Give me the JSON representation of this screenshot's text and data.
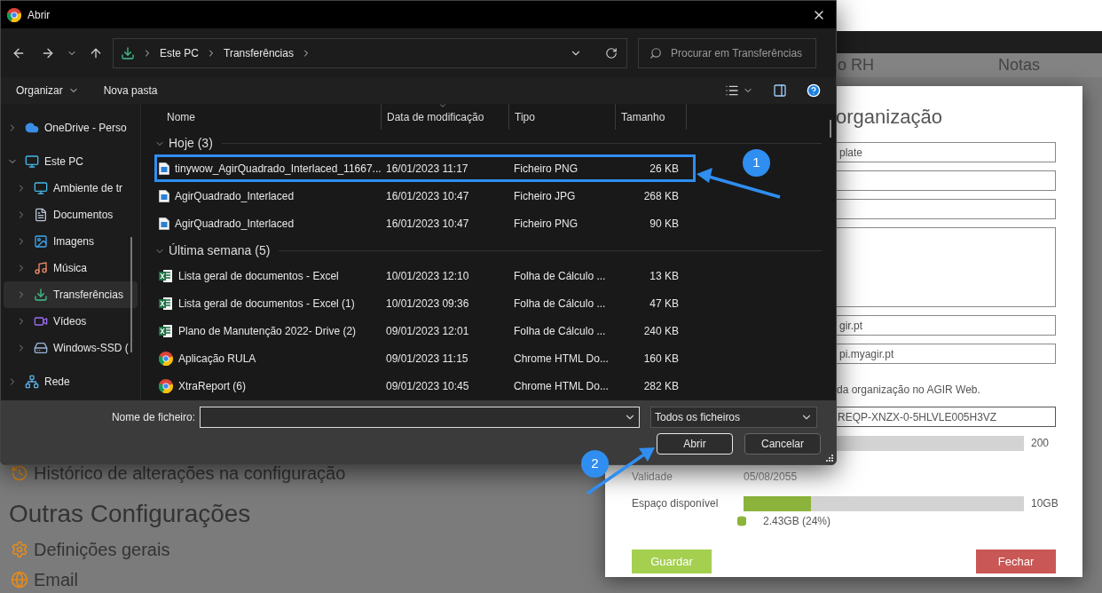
{
  "background": {
    "headers": [
      "o RH",
      "Notas"
    ],
    "items": [
      {
        "kind": "history",
        "label": "Histórico de alterações na configuração"
      }
    ],
    "section_title": "Outras Configurações",
    "links": [
      {
        "kind": "gear",
        "label": "Definições gerais"
      },
      {
        "kind": "globe",
        "label": "Email"
      }
    ]
  },
  "modal": {
    "title": "organização",
    "fields": [
      {
        "kind": "input",
        "value": "plate"
      },
      {
        "kind": "input"
      },
      {
        "kind": "input"
      },
      {
        "kind": "textarea"
      },
      {
        "kind": "input",
        "value": "gir.pt"
      },
      {
        "kind": "input",
        "value": "pi.myagir.pt"
      }
    ],
    "note": "da organização no AGIR Web.",
    "key_field": "REQP-XNZX-0-5HLVLE005H3VZ",
    "users_max": "200",
    "validity": {
      "label": "Validade",
      "value": "05/08/2055"
    },
    "storage": {
      "label": "Espaço disponível",
      "max": "10GB",
      "level": 0.24,
      "used": "2.43GB (24%)"
    },
    "buttons": [
      {
        "kind": "save",
        "label": "Guardar"
      },
      {
        "kind": "close",
        "label": "Fechar"
      }
    ]
  },
  "dialog": {
    "title": "Abrir",
    "breadcrumb": [
      "Este PC",
      "Transferências"
    ],
    "search": {
      "placeholder": "Procurar em Transferências"
    },
    "toolbar": [
      "Organizar",
      "Nova pasta"
    ],
    "sidebar": {
      "items": [
        {
          "kind": "cloud",
          "label": "OneDrive - Perso",
          "expanded": false,
          "selected": false
        },
        {
          "kind": "pc",
          "label": "Este PC",
          "expanded": true,
          "selected": false,
          "children": [
            {
              "kind": "desktop",
              "label": "Ambiente de tr",
              "expanded": false,
              "selected": false
            },
            {
              "kind": "documents",
              "label": "Documentos",
              "expanded": false,
              "selected": false
            },
            {
              "kind": "pictures",
              "label": "Imagens",
              "expanded": false,
              "selected": false
            },
            {
              "kind": "music",
              "label": "Música",
              "expanded": false,
              "selected": false
            },
            {
              "kind": "downloads",
              "label": "Transferências",
              "expanded": false,
              "selected": true
            },
            {
              "kind": "videos",
              "label": "Vídeos",
              "expanded": false,
              "selected": false
            },
            {
              "kind": "drive",
              "label": "Windows-SSD (",
              "expanded": false,
              "selected": false
            }
          ]
        },
        {
          "kind": "network",
          "label": "Rede",
          "expanded": false,
          "selected": false
        }
      ]
    },
    "columns": [
      "Nome",
      "Data de modificação",
      "Tipo",
      "Tamanho"
    ],
    "groups": [
      {
        "label": "Hoje (3)",
        "expanded": true,
        "files": [
          {
            "kind": "image",
            "name": "tinywow_AgirQuadrado_Interlaced_11667...",
            "date": "16/01/2023 11:17",
            "type": "Ficheiro PNG",
            "size": "26 KB",
            "selected": true
          },
          {
            "kind": "image",
            "name": "AgirQuadrado_Interlaced",
            "date": "16/01/2023 10:47",
            "type": "Ficheiro JPG",
            "size": "268 KB",
            "selected": false
          },
          {
            "kind": "image",
            "name": "AgirQuadrado_Interlaced",
            "date": "16/01/2023 10:47",
            "type": "Ficheiro PNG",
            "size": "90 KB",
            "selected": false
          }
        ]
      },
      {
        "label": "Última semana (5)",
        "expanded": true,
        "files": [
          {
            "kind": "excel",
            "name": "Lista geral de documentos - Excel",
            "date": "10/01/2023 12:10",
            "type": "Folha de Cálculo ...",
            "size": "13 KB",
            "selected": false
          },
          {
            "kind": "excel",
            "name": "Lista geral de documentos - Excel (1)",
            "date": "10/01/2023 09:36",
            "type": "Folha de Cálculo ...",
            "size": "47 KB",
            "selected": false
          },
          {
            "kind": "excel",
            "name": "Plano de Manutenção 2022- Drive (2)",
            "date": "09/01/2023 12:01",
            "type": "Folha de Cálculo ...",
            "size": "240 KB",
            "selected": false
          },
          {
            "kind": "chrome",
            "name": "Aplicação RULA",
            "date": "09/01/2023 11:15",
            "type": "Chrome HTML Do...",
            "size": "160 KB",
            "selected": false
          },
          {
            "kind": "chrome",
            "name": "XtraReport (6)",
            "date": "09/01/2023 10:45",
            "type": "Chrome HTML Do...",
            "size": "282 KB",
            "selected": false
          }
        ]
      }
    ],
    "filename": {
      "label": "Nome de ficheiro:"
    },
    "filter": "Todos os ficheiros",
    "buttons": [
      {
        "label": "Abrir",
        "focused": true
      },
      {
        "label": "Cancelar",
        "focused": false
      }
    ]
  },
  "annotations": [
    "1",
    "2"
  ]
}
